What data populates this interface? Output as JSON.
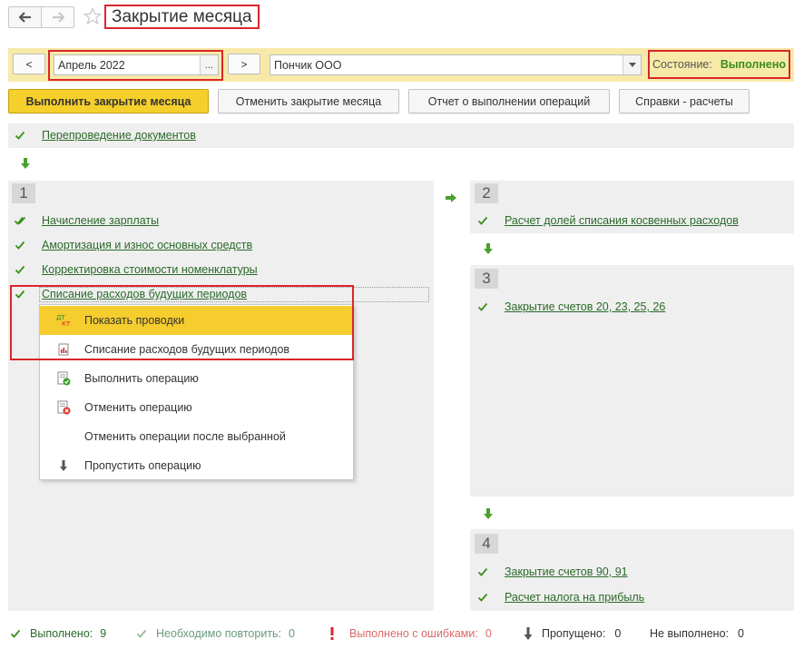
{
  "window": {
    "title": "Закрытие месяца"
  },
  "toolbar": {
    "prev_label": "<",
    "next_label": ">",
    "period_value": "Апрель 2022",
    "period_button": "...",
    "organization_value": "Пончик ООО",
    "state_label": "Состояние:",
    "state_value": "Выполнено"
  },
  "actions": {
    "close_month": "Выполнить закрытие месяца",
    "cancel_close": "Отменить закрытие месяца",
    "report": "Отчет о выполнении операций",
    "references": "Справки - расчеты"
  },
  "pre_step": {
    "label": "Перепроведение документов"
  },
  "steps": [
    {
      "number": "1",
      "items": [
        "Начисление зарплаты",
        "Амортизация и износ основных средств",
        "Корректировка стоимости номенклатуры",
        "Списание расходов будущих периодов"
      ]
    },
    {
      "number": "2",
      "items": [
        "Расчет долей списания косвенных расходов"
      ]
    },
    {
      "number": "3",
      "items": [
        "Закрытие счетов 20, 23, 25, 26"
      ]
    },
    {
      "number": "4",
      "items": [
        "Закрытие счетов 90, 91",
        "Расчет налога на прибыль"
      ]
    }
  ],
  "context_menu": {
    "items": [
      {
        "label": "Показать проводки",
        "icon": "dt-kt-icon"
      },
      {
        "label": "Списание расходов будущих периодов",
        "icon": "report-icon"
      },
      {
        "label": "Выполнить операцию",
        "icon": "execute-icon"
      },
      {
        "label": "Отменить операцию",
        "icon": "cancel-operation-icon"
      },
      {
        "label": "Отменить операции после выбранной",
        "icon": ""
      },
      {
        "label": "Пропустить операцию",
        "icon": "skip-arrow-icon"
      }
    ],
    "icon_text": {
      "dt": "ДТ",
      "kt": "КТ"
    }
  },
  "status_bar": {
    "done_label": "Выполнено:",
    "done_count": "9",
    "repeat_label": "Необходимо повторить:",
    "repeat_count": "0",
    "errors_label": "Выполнено с ошибками:",
    "errors_count": "0",
    "skipped_label": "Пропущено:",
    "skipped_count": "0",
    "not_done_label": "Не выполнено:",
    "not_done_count": "0"
  },
  "colors": {
    "accent_yellow": "#f5cf2a",
    "band_yellow": "#f7eaa9",
    "highlight_red": "#d9262b",
    "success_green": "#3a8f1a",
    "link_green": "#2b6a2a",
    "panel_gray": "#efefef"
  }
}
